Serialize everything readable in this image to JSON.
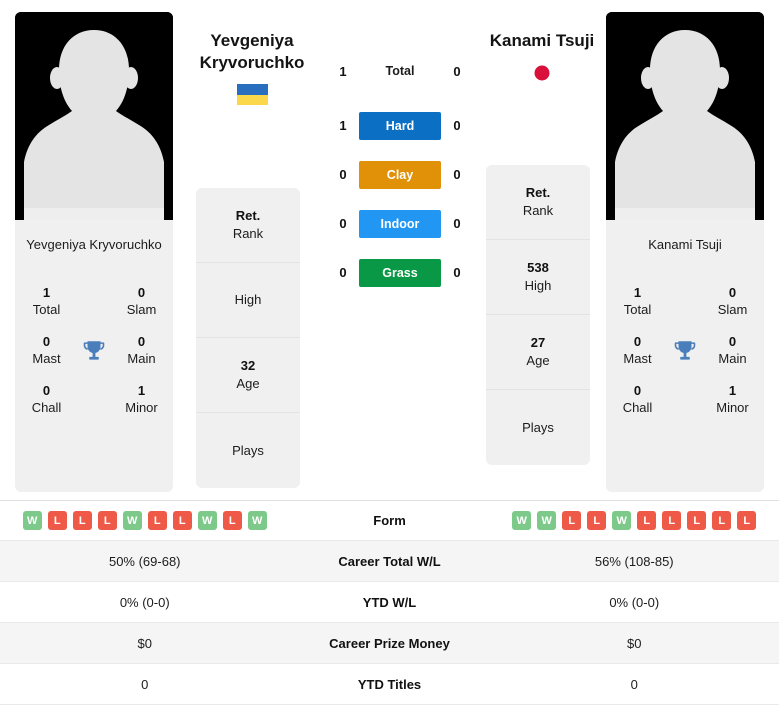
{
  "players": {
    "left": {
      "name": "Yevgeniya Kryvoruchko",
      "card_name": "Yevgeniya Kryvoruchko",
      "country_code": "ua",
      "country_icon": "ukraine-flag-icon",
      "titles": {
        "total_value": "1",
        "total_label": "Total",
        "slam_value": "0",
        "slam_label": "Slam",
        "mast_value": "0",
        "mast_label": "Mast",
        "main_value": "0",
        "main_label": "Main",
        "chall_value": "0",
        "chall_label": "Chall",
        "minor_value": "1",
        "minor_label": "Minor",
        "trophy_icon": "trophy-icon"
      },
      "info": [
        {
          "value": "Ret.",
          "label": "Rank"
        },
        {
          "value": "",
          "label": "High"
        },
        {
          "value": "32",
          "label": "Age"
        },
        {
          "value": "",
          "label": "Plays"
        }
      ],
      "form": [
        "W",
        "L",
        "L",
        "L",
        "W",
        "L",
        "L",
        "W",
        "L",
        "W"
      ],
      "career_total_wl": "50% (69-68)",
      "ytd_wl": "0% (0-0)",
      "career_prize_money": "$0",
      "ytd_titles": "0"
    },
    "right": {
      "name": "Kanami Tsuji",
      "card_name": "Kanami Tsuji",
      "country_code": "jp",
      "country_icon": "japan-flag-icon",
      "titles": {
        "total_value": "1",
        "total_label": "Total",
        "slam_value": "0",
        "slam_label": "Slam",
        "mast_value": "0",
        "mast_label": "Mast",
        "main_value": "0",
        "main_label": "Main",
        "chall_value": "0",
        "chall_label": "Chall",
        "minor_value": "1",
        "minor_label": "Minor",
        "trophy_icon": "trophy-icon"
      },
      "info": [
        {
          "value": "Ret.",
          "label": "Rank"
        },
        {
          "value": "538",
          "label": "High"
        },
        {
          "value": "27",
          "label": "Age"
        },
        {
          "value": "",
          "label": "Plays"
        }
      ],
      "form": [
        "W",
        "W",
        "L",
        "L",
        "W",
        "L",
        "L",
        "L",
        "L",
        "L"
      ],
      "career_total_wl": "56% (108-85)",
      "ytd_wl": "0% (0-0)",
      "career_prize_money": "$0",
      "ytd_titles": "0"
    }
  },
  "head_to_head": {
    "rows": [
      {
        "label": "Total",
        "left": "1",
        "right": "0",
        "color": "",
        "style": "plain"
      },
      {
        "label": "Hard",
        "left": "1",
        "right": "0",
        "color": "#0B6FC4",
        "style": "bar"
      },
      {
        "label": "Clay",
        "left": "0",
        "right": "0",
        "color": "#E09107",
        "style": "bar"
      },
      {
        "label": "Indoor",
        "left": "0",
        "right": "0",
        "color": "#2196F3",
        "style": "bar"
      },
      {
        "label": "Grass",
        "left": "0",
        "right": "0",
        "color": "#099845",
        "style": "bar"
      }
    ]
  },
  "comparison_table": {
    "rows": [
      {
        "label": "Form",
        "key": "form",
        "type": "badges"
      },
      {
        "label": "Career Total W/L",
        "key": "career_total_wl",
        "type": "text"
      },
      {
        "label": "YTD W/L",
        "key": "ytd_wl",
        "type": "text"
      },
      {
        "label": "Career Prize Money",
        "key": "career_prize_money",
        "type": "text"
      },
      {
        "label": "YTD Titles",
        "key": "ytd_titles",
        "type": "text"
      }
    ]
  },
  "colors": {
    "hard": "#0B6FC4",
    "clay": "#E09107",
    "indoor": "#2196F3",
    "grass": "#099845",
    "win_badge": "#7DC98A",
    "loss_badge": "#EE5A47",
    "trophy": "#4A7EBB",
    "card_bg": "#F0F0F0"
  }
}
